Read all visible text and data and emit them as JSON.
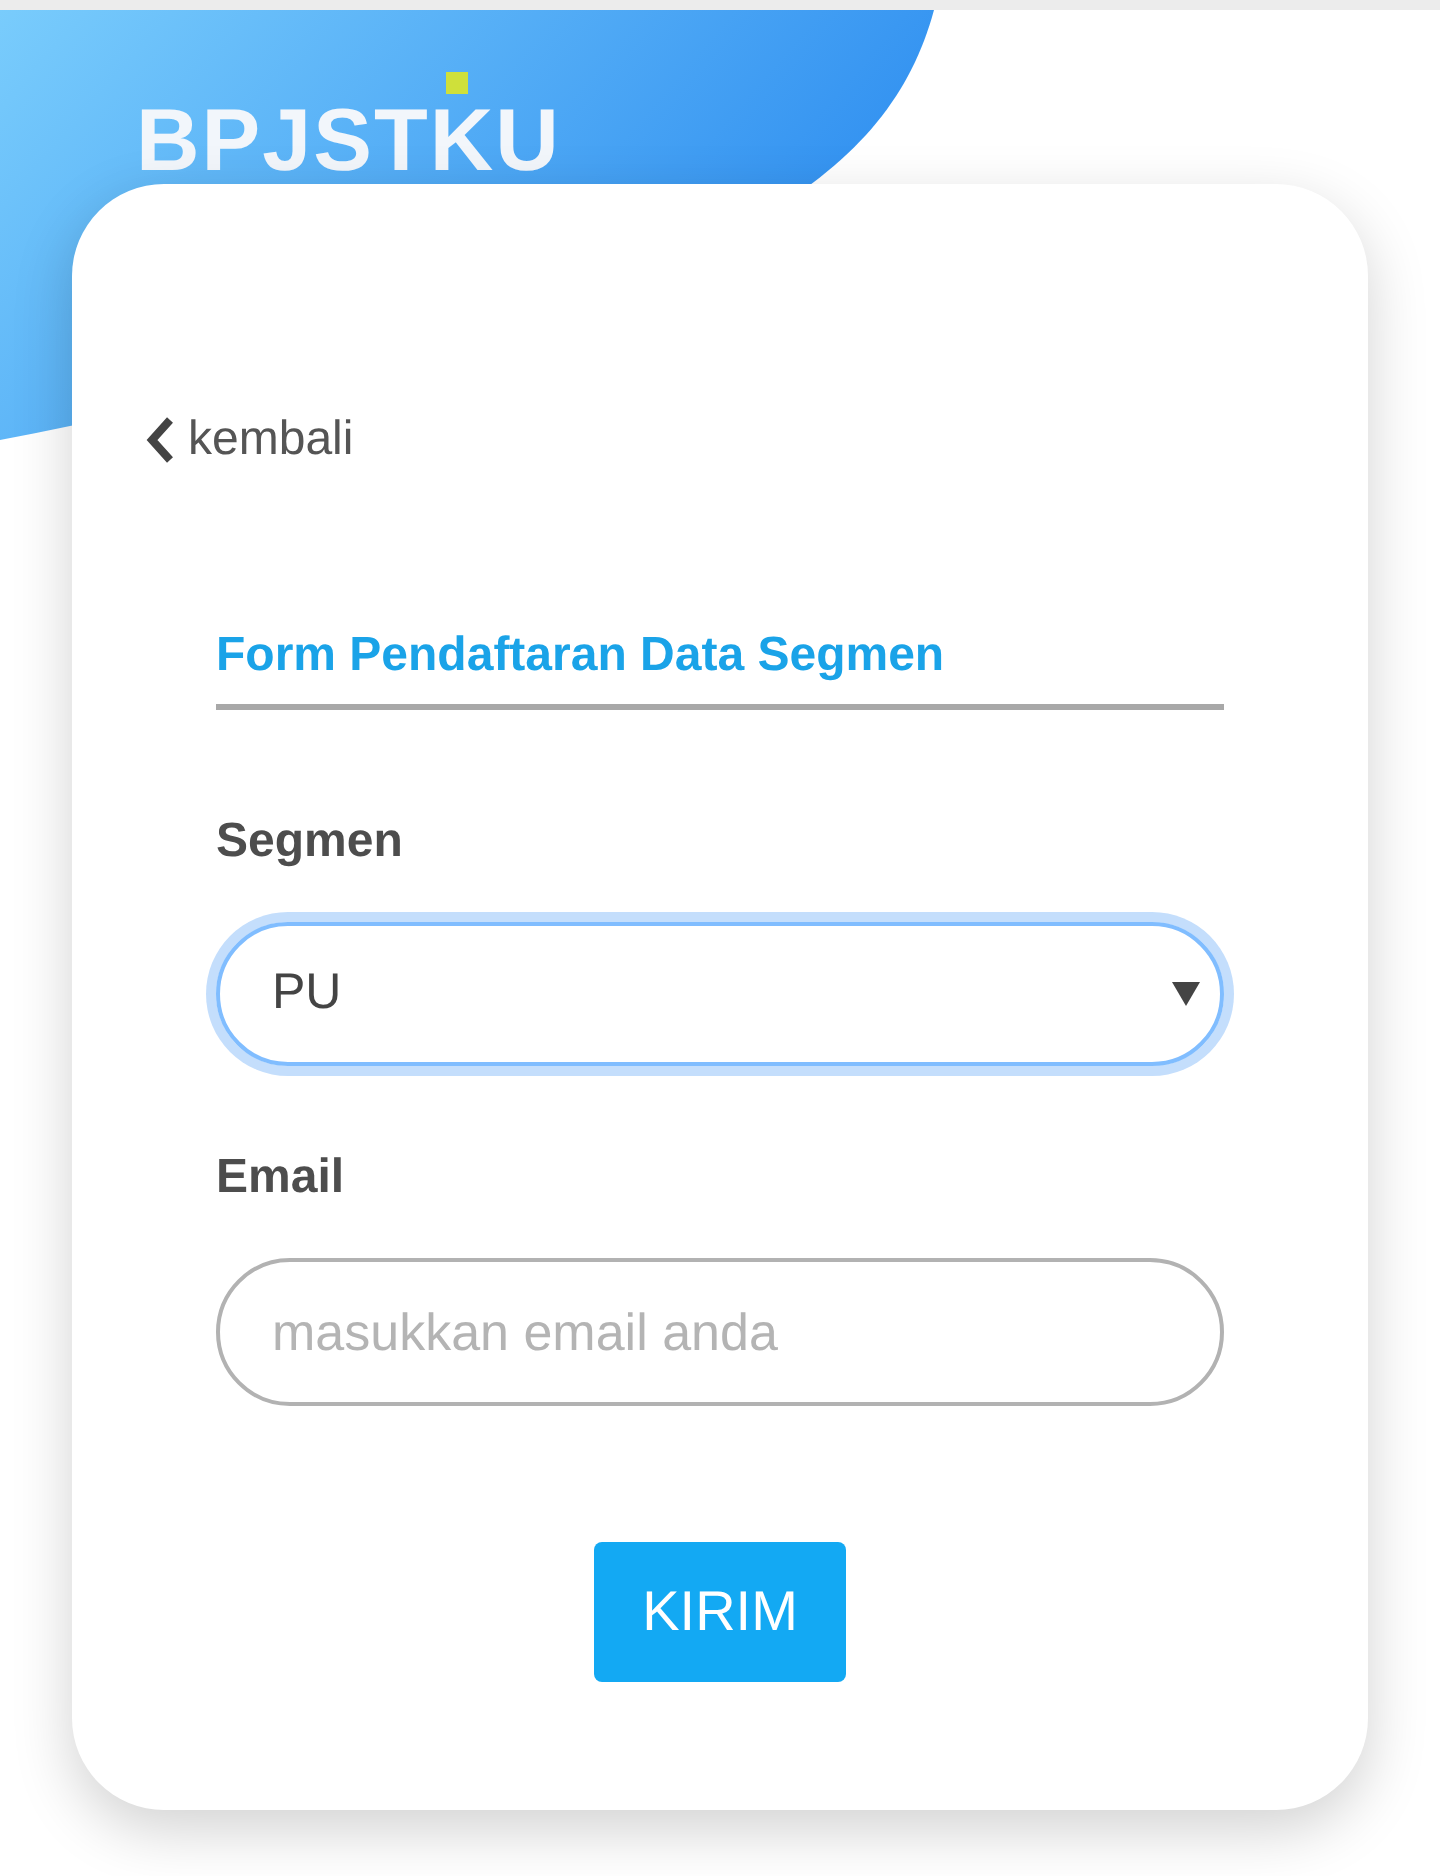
{
  "logo": {
    "text": "BPJSTKU"
  },
  "back_link": {
    "label": "kembali"
  },
  "form": {
    "title": "Form Pendaftaran Data Segmen",
    "fields": [
      {
        "kind": "select",
        "label": "Segmen",
        "value": "PU",
        "focused": true
      },
      {
        "kind": "input",
        "label": "Email",
        "placeholder": "masukkan email anda",
        "focused": false
      }
    ],
    "submit": "KIRIM"
  }
}
